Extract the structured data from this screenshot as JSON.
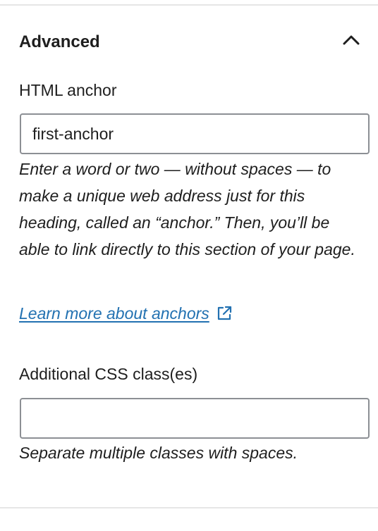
{
  "panel": {
    "title": "Advanced",
    "expanded": true,
    "toggle_icon": "chevron-up-icon"
  },
  "html_anchor": {
    "label": "HTML anchor",
    "value": "first-anchor",
    "help": "Enter a word or two — without spaces — to make a unique web address just for this heading, called an “anchor.” Then, you’ll be able to link directly to this section of your page.",
    "link_text": "Learn more about anchors",
    "link_icon": "external-link-icon"
  },
  "css_classes": {
    "label": "Additional CSS class(es)",
    "value": "",
    "help": "Separate multiple classes with spaces."
  },
  "colors": {
    "text": "#1e1e1e",
    "link": "#2271b1",
    "input_border": "#8c8f94",
    "divider": "#e6e6e6"
  }
}
